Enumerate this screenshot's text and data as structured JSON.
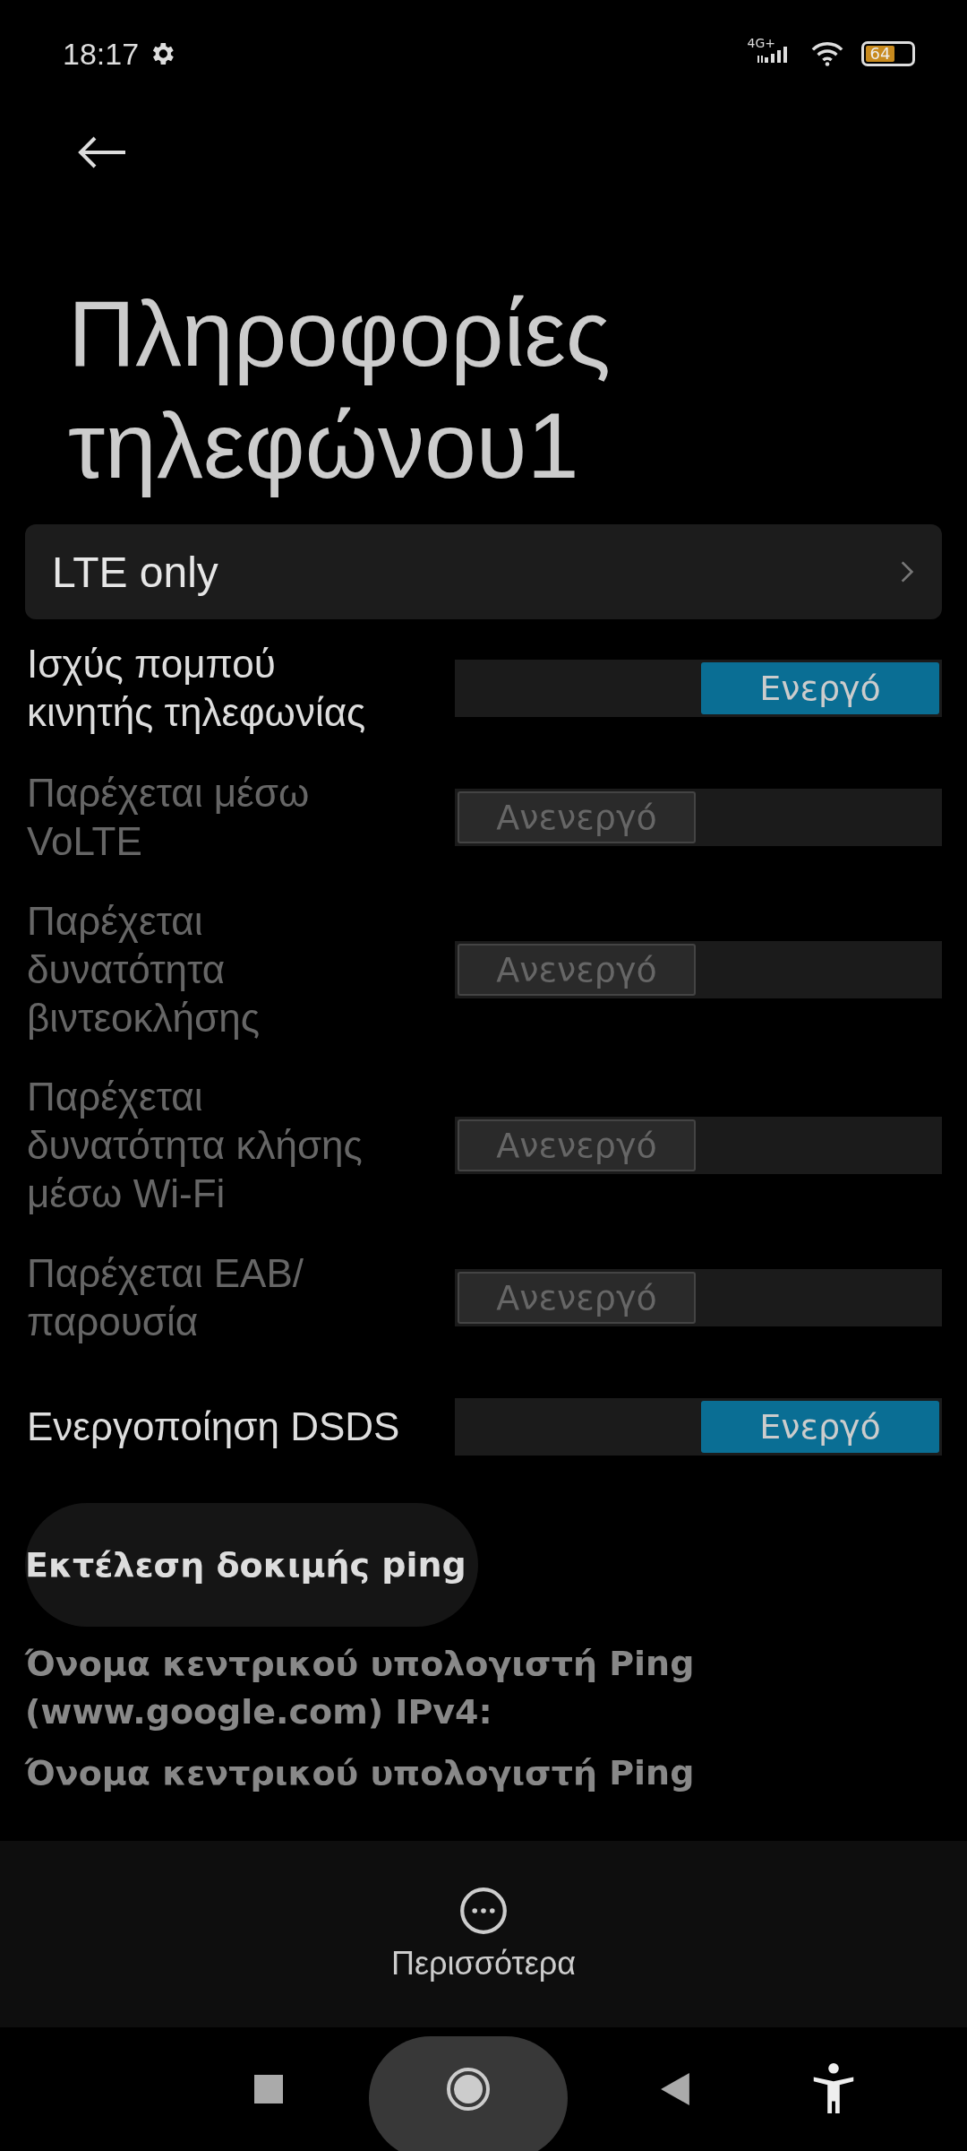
{
  "status_bar": {
    "time": "18:17",
    "network": "4G+",
    "battery": "64"
  },
  "title": "Πληροφορίες τηλεφώνου1",
  "network_mode": {
    "label": "LTE only"
  },
  "settings": [
    {
      "label": "Ισχύς πομπού κινητής τηλεφωνίας",
      "disabled": false,
      "on": true,
      "state_text": "Ενεργό"
    },
    {
      "label": "Παρέχεται μέσω VoLTE",
      "disabled": true,
      "on": false,
      "state_text": "Ανενεργό"
    },
    {
      "label": "Παρέχεται δυνατότητα βιντεοκλήσης",
      "disabled": true,
      "on": false,
      "state_text": "Ανενεργό"
    },
    {
      "label": "Παρέχεται δυνατότητα κλήσης μέσω Wi-Fi",
      "disabled": true,
      "on": false,
      "state_text": "Ανενεργό"
    },
    {
      "label": "Παρέχεται EAB/ παρουσία",
      "disabled": true,
      "on": false,
      "state_text": "Ανενεργό"
    },
    {
      "label": "Ενεργοποίηση DSDS",
      "disabled": false,
      "on": true,
      "state_text": "Ενεργό"
    }
  ],
  "ping_button": "Εκτέλεση δοκιμής ping",
  "ping_info": [
    "Όνομα κεντρικού υπολογιστή Ping (www.google.com) IPv4:",
    "Όνομα κεντρικού υπολογιστή Ping"
  ],
  "bottom_action": {
    "label": "Περισσότερα"
  }
}
